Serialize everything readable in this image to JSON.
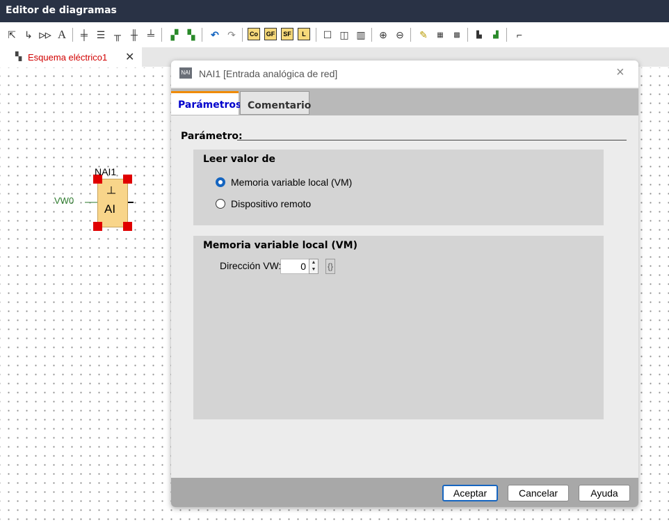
{
  "app": {
    "title": "Editor de diagramas"
  },
  "toolbar": {
    "box_labels": [
      "Co",
      "GF",
      "SF",
      "L"
    ]
  },
  "document_tab": {
    "label": "Esquema eléctrico1",
    "close": "✕"
  },
  "diagram": {
    "block_name": "NAI1",
    "block_text": "AI",
    "input_label": "VW0"
  },
  "dialog": {
    "title": "NAI1 [Entrada analógica de red]",
    "icon_text": "NAI",
    "close": "×",
    "tabs": [
      "Parámetros",
      "Comentario"
    ],
    "group_label": "Parámetro:",
    "section1": {
      "title": "Leer valor de",
      "options": [
        "Memoria variable local (VM)",
        "Dispositivo remoto"
      ],
      "selected_index": 0
    },
    "section2": {
      "title": "Memoria variable local (VM)",
      "field_label": "Dirección VW:",
      "field_value": "0"
    },
    "buttons": {
      "ok": "Aceptar",
      "cancel": "Cancelar",
      "help": "Ayuda"
    }
  }
}
